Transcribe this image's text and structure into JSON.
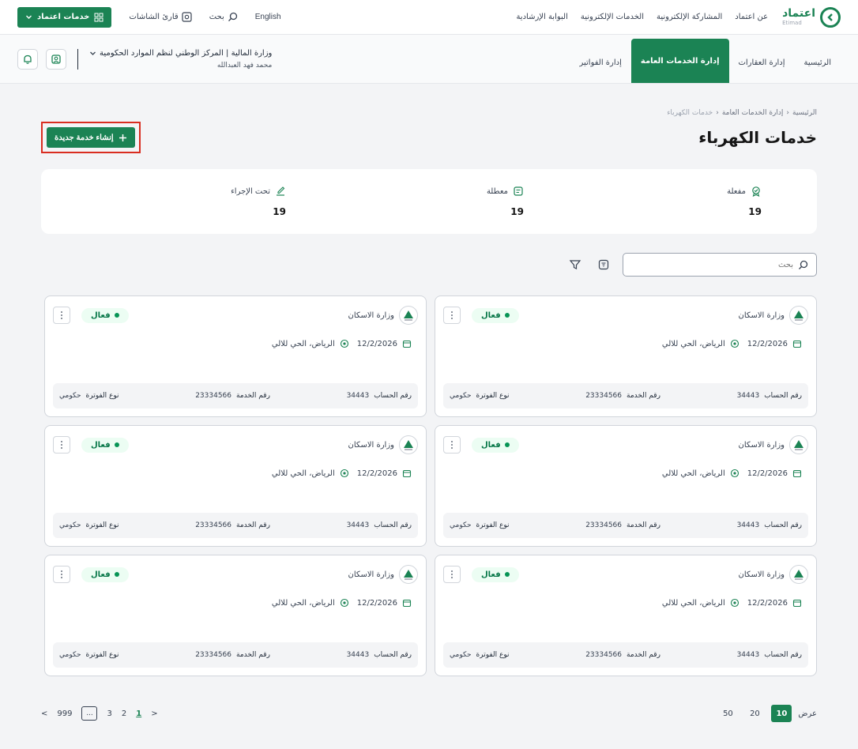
{
  "topbar": {
    "logo_ar": "اعتماد",
    "logo_en": "Etimad",
    "nav": [
      "عن اعتماد",
      "المشاركة الإلكترونية",
      "الخدمات الإلكترونية",
      "البوابة الإرشادية"
    ],
    "language": "English",
    "search": "بحث",
    "screen_reader": "قارئ الشاشات",
    "etimad_services": "خدمات اعتماد"
  },
  "subbar": {
    "tabs": [
      {
        "label": "الرئيسية"
      },
      {
        "label": "إدارة العقارات"
      },
      {
        "label": "إدارة الخدمات العامة",
        "active": true
      },
      {
        "label": "إدارة الفواتير"
      }
    ],
    "org": "وزارة المالية | المركز الوطني لنظم الموارد الحكومية",
    "user": "محمد فهد العبدالله"
  },
  "breadcrumb": {
    "home": "الرئيسية",
    "section": "إدارة الخدمات العامة",
    "current": "خدمات الكهرباء"
  },
  "page_title": "خدمات الكهرباء",
  "create_button": "إنشاء خدمة جديدة",
  "stats": [
    {
      "label": "مفعلة",
      "value": "19"
    },
    {
      "label": "معطلة",
      "value": "19"
    },
    {
      "label": "تحت الإجراء",
      "value": "19"
    }
  ],
  "search_placeholder": "بحث",
  "cards": [
    {
      "org": "وزارة الاسكان",
      "status": "فعال",
      "date": "12/2/2026",
      "location": "الرياض، الحي للالي",
      "account_label": "رقم الحساب",
      "account": "34443",
      "service_label": "رقم الخدمة",
      "service": "23334566",
      "bill_label": "نوع الفوترة",
      "bill": "حكومي"
    },
    {
      "org": "وزارة الاسكان",
      "status": "فعال",
      "date": "12/2/2026",
      "location": "الرياض، الحي للالي",
      "account_label": "رقم الحساب",
      "account": "34443",
      "service_label": "رقم الخدمة",
      "service": "23334566",
      "bill_label": "نوع الفوترة",
      "bill": "حكومي"
    },
    {
      "org": "وزارة الاسكان",
      "status": "فعال",
      "date": "12/2/2026",
      "location": "الرياض، الحي للالي",
      "account_label": "رقم الحساب",
      "account": "34443",
      "service_label": "رقم الخدمة",
      "service": "23334566",
      "bill_label": "نوع الفوترة",
      "bill": "حكومي"
    },
    {
      "org": "وزارة الاسكان",
      "status": "فعال",
      "date": "12/2/2026",
      "location": "الرياض، الحي للالي",
      "account_label": "رقم الحساب",
      "account": "34443",
      "service_label": "رقم الخدمة",
      "service": "23334566",
      "bill_label": "نوع الفوترة",
      "bill": "حكومي"
    },
    {
      "org": "وزارة الاسكان",
      "status": "فعال",
      "date": "12/2/2026",
      "location": "الرياض، الحي للالي",
      "account_label": "رقم الحساب",
      "account": "34443",
      "service_label": "رقم الخدمة",
      "service": "23334566",
      "bill_label": "نوع الفوترة",
      "bill": "حكومي"
    },
    {
      "org": "وزارة الاسكان",
      "status": "فعال",
      "date": "12/2/2026",
      "location": "الرياض، الحي للالي",
      "account_label": "رقم الحساب",
      "account": "34443",
      "service_label": "رقم الخدمة",
      "service": "23334566",
      "bill_label": "نوع الفوترة",
      "bill": "حكومي"
    }
  ],
  "pager": {
    "show_label": "عرض",
    "sizes": [
      "10",
      "20",
      "50"
    ],
    "active_size": "10",
    "pages": [
      "1",
      "2",
      "3"
    ],
    "ellipsis": "...",
    "last": "999",
    "prev": "<",
    "next": ">"
  },
  "colors": {
    "primary": "#1b8354",
    "highlight": "#d92d20",
    "badge_bg": "#ecfdf3"
  }
}
